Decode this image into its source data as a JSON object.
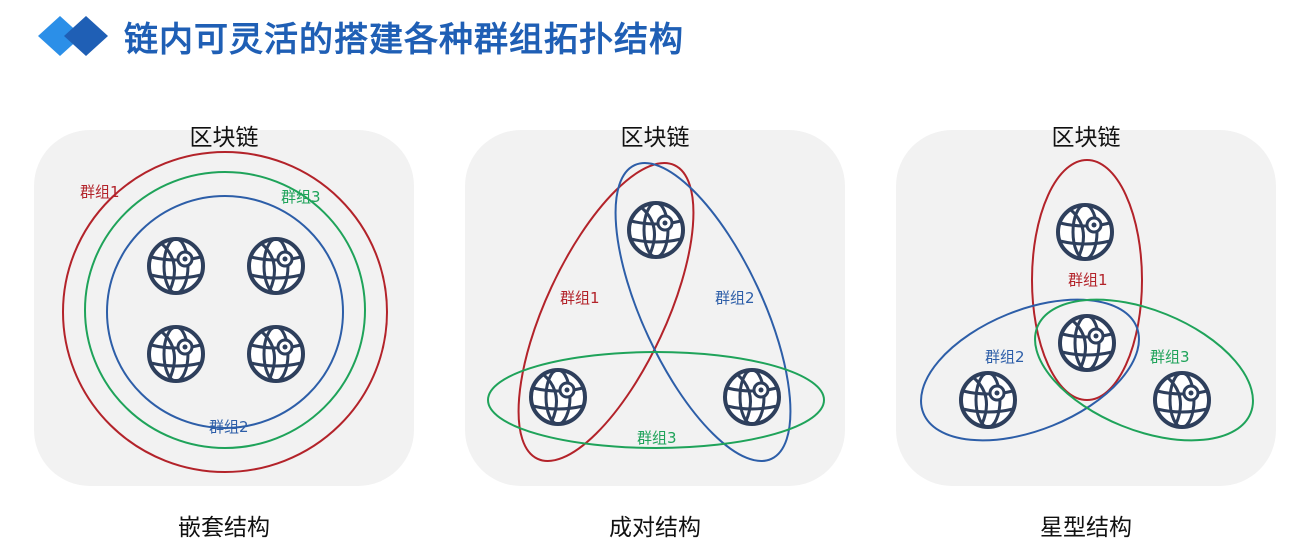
{
  "header": {
    "title": "链内可灵活的搭建各种群组拓扑结构"
  },
  "panels": [
    {
      "title": "区块链",
      "caption": "嵌套结构",
      "groups": [
        "群组1",
        "群组3",
        "群组2"
      ]
    },
    {
      "title": "区块链",
      "caption": "成对结构",
      "groups": [
        "群组1",
        "群组2",
        "群组3"
      ]
    },
    {
      "title": "区块链",
      "caption": "星型结构",
      "groups": [
        "群组1",
        "群组2",
        "群组3"
      ]
    }
  ],
  "colors": {
    "accent": "#1f5fb5",
    "group_red": "#b3232a",
    "group_green": "#1fa35a",
    "group_blue": "#2d5ea8",
    "node": "#2e3f5c",
    "panel_bg": "#f2f2f2"
  },
  "icons": {
    "header": "diamond-icon",
    "node": "globe-icon"
  }
}
